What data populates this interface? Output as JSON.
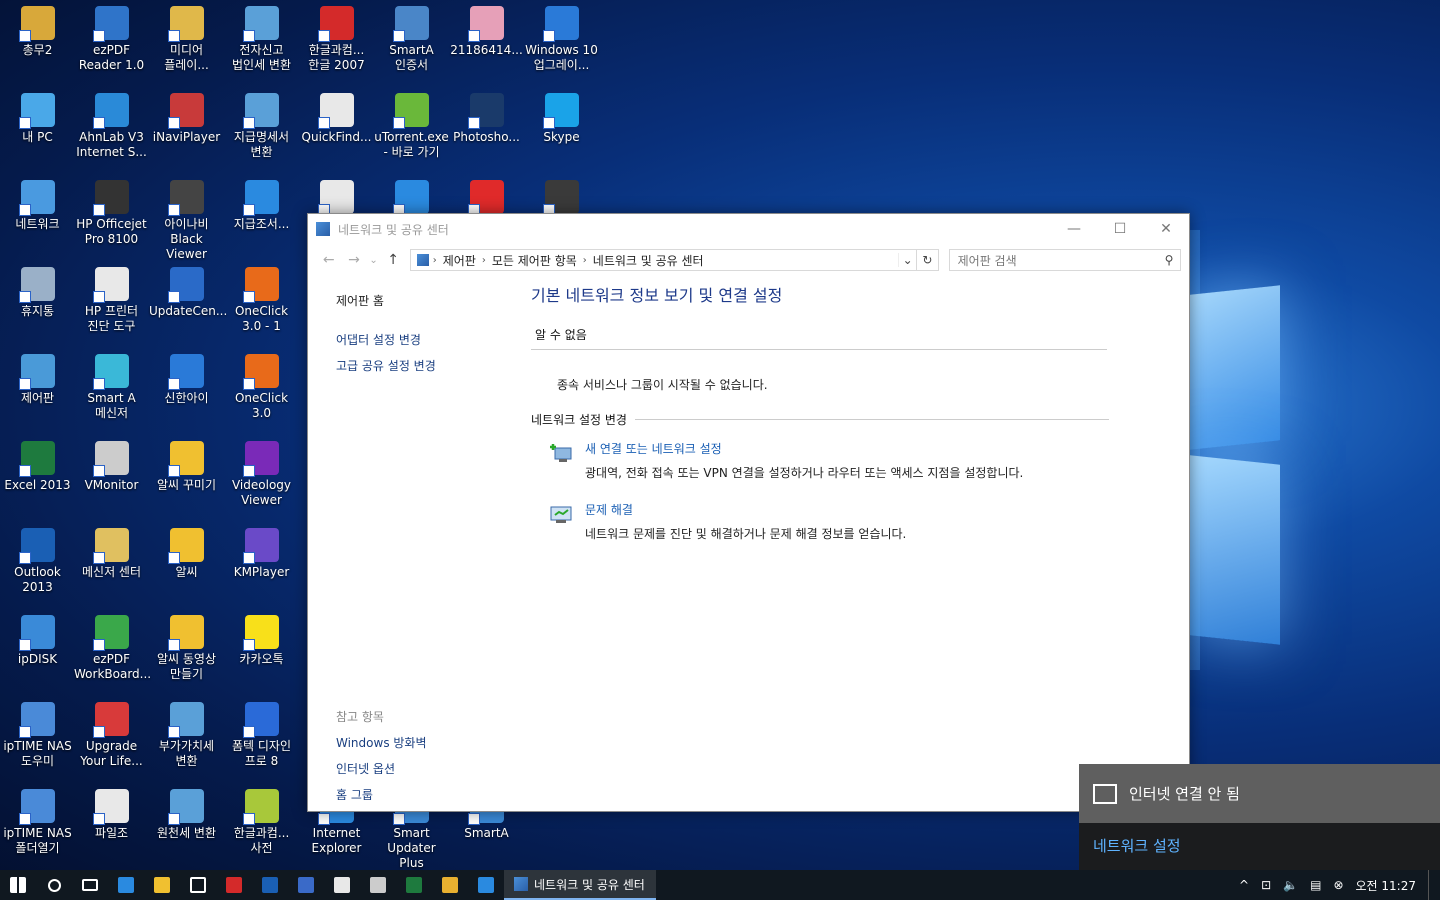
{
  "desktop_icons": [
    {
      "label": "총무2",
      "color": "#d8a83a"
    },
    {
      "label": "ezPDF Reader 1.0",
      "color": "#2f74c9"
    },
    {
      "label": "미디어 플레이...",
      "color": "#e0b84a"
    },
    {
      "label": "전자신고 법인세 변환",
      "color": "#5aa0d8"
    },
    {
      "label": "한글과컴... 한글 2007",
      "color": "#d42a2a"
    },
    {
      "label": "SmartA 인증서",
      "color": "#4a86c8"
    },
    {
      "label": "21186414...",
      "color": "#e6a0b8"
    },
    {
      "label": "Windows 10 업그레이...",
      "color": "#2a7ad8"
    },
    {
      "label": "내 PC",
      "color": "#4aa8e8"
    },
    {
      "label": "AhnLab V3 Internet S...",
      "color": "#2a8ad8"
    },
    {
      "label": "iNaviPlayer",
      "color": "#c83a3a"
    },
    {
      "label": "지급명세서 변환",
      "color": "#5aa0d8"
    },
    {
      "label": "QuickFind...",
      "color": "#e8e8e8"
    },
    {
      "label": "uTorrent.exe - 바로 가기",
      "color": "#6ab83a"
    },
    {
      "label": "Photosho...",
      "color": "#1a3a6a"
    },
    {
      "label": "Skype",
      "color": "#1aa3e8"
    },
    {
      "label": "네트워크",
      "color": "#4a9ae0"
    },
    {
      "label": "HP Officejet Pro 8100",
      "color": "#333333"
    },
    {
      "label": "아이나비 Black Viewer",
      "color": "#444444"
    },
    {
      "label": "지급조서...",
      "color": "#2a8ae0"
    },
    {
      "label": "휴지통",
      "color": "#9ab0c8"
    },
    {
      "label": "HP 프린터 진단 도구",
      "color": "#e8e8e8"
    },
    {
      "label": "UpdateCen...",
      "color": "#2a6ac8"
    },
    {
      "label": "OneClick 3.0 - 1",
      "color": "#e86a1a"
    },
    {
      "label": "제어판",
      "color": "#4a9ad8"
    },
    {
      "label": "Smart A 메신저",
      "color": "#3ab8d8"
    },
    {
      "label": "신한아이",
      "color": "#2a7ad8"
    },
    {
      "label": "OneClick 3.0",
      "color": "#e86a1a"
    },
    {
      "label": "Excel 2013",
      "color": "#1e7a3e"
    },
    {
      "label": "VMonitor",
      "color": "#cccccc"
    },
    {
      "label": "알씨 꾸미기",
      "color": "#f0c030"
    },
    {
      "label": "Videology Viewer",
      "color": "#7a2ab8"
    },
    {
      "label": "Outlook 2013",
      "color": "#1a5fb4"
    },
    {
      "label": "메신저 센터",
      "color": "#e0c060"
    },
    {
      "label": "알씨",
      "color": "#f0c030"
    },
    {
      "label": "KMPlayer",
      "color": "#6a4ac8"
    },
    {
      "label": "ipDISK",
      "color": "#3a8ad8"
    },
    {
      "label": "ezPDF WorkBoard...",
      "color": "#3aa84a"
    },
    {
      "label": "알씨 동영상 만들기",
      "color": "#f0c030"
    },
    {
      "label": "카카오톡",
      "color": "#f8e01a"
    },
    {
      "label": "ipTIME NAS 도우미",
      "color": "#4a8ad8"
    },
    {
      "label": "Upgrade Your Life...",
      "color": "#d83a3a"
    },
    {
      "label": "부가가치세 변환",
      "color": "#5aa0d8"
    },
    {
      "label": "폼텍 디자인 프로 8",
      "color": "#2a6ad8"
    },
    {
      "label": "ipTIME NAS 폴더열기",
      "color": "#4a8ad8"
    },
    {
      "label": "파일조",
      "color": "#e8e8e8"
    },
    {
      "label": "원천세 변환",
      "color": "#5aa0d8"
    },
    {
      "label": "한글과컴... 사전",
      "color": "#a8c83a"
    }
  ],
  "desktop_icons_bottom": [
    {
      "label": "Internet Explorer",
      "color": "#2a8ae0"
    },
    {
      "label": "Smart Updater Plus",
      "color": "#3a8ad8"
    },
    {
      "label": "SmartA",
      "color": "#3a8ad8"
    }
  ],
  "desktop_icons_top_row3": [
    {
      "label": "",
      "color": "#e8e8e8"
    },
    {
      "label": "",
      "color": "#2a8ae0"
    },
    {
      "label": "",
      "color": "#e02a2a"
    },
    {
      "label": "",
      "color": "#3a3a3a"
    }
  ],
  "window": {
    "title": "네트워크 및 공유 센터",
    "controls": {
      "minimize": "—",
      "maximize": "☐",
      "close": "✕"
    },
    "nav": {
      "back": "←",
      "forward": "→",
      "recent": "⌄",
      "up": "↑"
    },
    "breadcrumb": [
      "제어판",
      "모든 제어판 항목",
      "네트워크 및 공유 센터"
    ],
    "search_placeholder": "제어판 검색",
    "sidebar": {
      "home": "제어판 홈",
      "links": [
        "어댑터 설정 변경",
        "고급 공유 설정 변경"
      ]
    },
    "see_also": {
      "header": "참고 항목",
      "links": [
        "Windows 방화벽",
        "인터넷 옵션",
        "홈 그룹"
      ]
    },
    "main": {
      "title": "기본 네트워크 정보 보기 및 연결 설정",
      "unknown_header": "알 수 없음",
      "unknown_message": "종속 서비스나 그룹이 시작될 수 없습니다.",
      "change_header": "네트워크 설정 변경",
      "tasks": [
        {
          "link": "새 연결 또는 네트워크 설정",
          "desc": "광대역, 전화 접속 또는 VPN 연결을 설정하거나 라우터 또는 액세스 지점을 설정합니다."
        },
        {
          "link": "문제 해결",
          "desc": "네트워크 문제를 진단 및 해결하거나 문제 해결 정보를 얻습니다."
        }
      ]
    }
  },
  "flyout": {
    "status": "인터넷 연결 안 됨",
    "settings_link": "네트워크 설정"
  },
  "taskbar": {
    "pinned": [
      {
        "name": "start",
        "color": "#ffffff"
      },
      {
        "name": "search",
        "color": "#ffffff"
      },
      {
        "name": "task-view",
        "color": "#ffffff"
      },
      {
        "name": "edge",
        "color": "#2a8ae0"
      },
      {
        "name": "file-explorer",
        "color": "#f0c030"
      },
      {
        "name": "store",
        "color": "#ffffff"
      },
      {
        "name": "app-red",
        "color": "#d42a2a"
      },
      {
        "name": "outlook",
        "color": "#1a5fb4"
      },
      {
        "name": "app-blue",
        "color": "#3a6ac8"
      },
      {
        "name": "app-doc",
        "color": "#e8e8e8"
      },
      {
        "name": "app-qr",
        "color": "#cccccc"
      },
      {
        "name": "excel",
        "color": "#1e7a3e"
      },
      {
        "name": "chrome",
        "color": "#e8b030"
      },
      {
        "name": "ie",
        "color": "#2a8ae0"
      }
    ],
    "active_app": "네트워크 및 공유 센터",
    "tray": {
      "chevron": "^",
      "network": "⊡",
      "volume": "🔈",
      "message": "▤",
      "error": "⊗"
    },
    "clock": "오전 11:27"
  }
}
